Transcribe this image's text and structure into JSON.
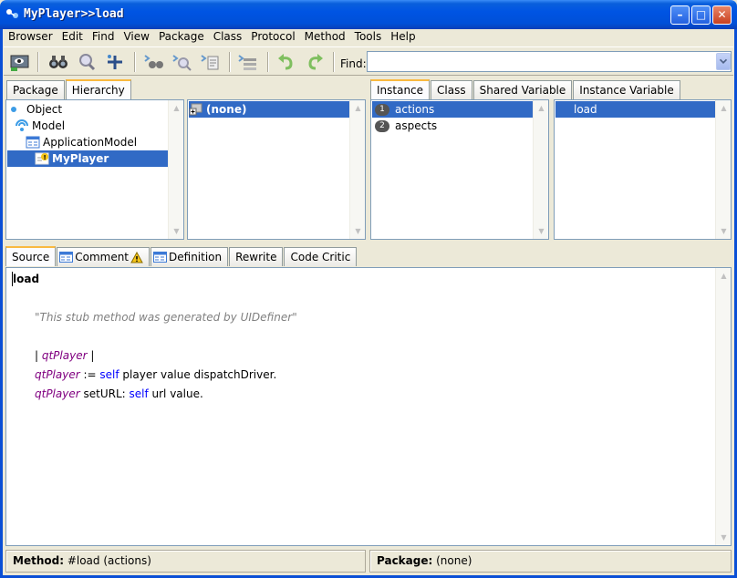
{
  "window": {
    "title": "MyPlayer>>load"
  },
  "menu": [
    "Browser",
    "Edit",
    "Find",
    "View",
    "Package",
    "Class",
    "Protocol",
    "Method",
    "Tools",
    "Help"
  ],
  "toolbar": {
    "find_label": "Find:",
    "find_value": ""
  },
  "left_tabs": [
    "Package",
    "Hierarchy"
  ],
  "hierarchy": [
    {
      "label": "Object",
      "icon": "dot-icon"
    },
    {
      "label": "Model",
      "icon": "model-icon"
    },
    {
      "label": "ApplicationModel",
      "icon": "appmodel-icon"
    },
    {
      "label": "MyPlayer",
      "icon": "myplayer-icon",
      "selected": true
    }
  ],
  "categories": [
    {
      "label": "(none)",
      "selected": true
    }
  ],
  "right_tabs": [
    "Instance",
    "Class",
    "Shared Variable",
    "Instance Variable"
  ],
  "protocols": [
    {
      "num": "1",
      "label": "actions",
      "selected": true
    },
    {
      "num": "2",
      "label": "aspects"
    }
  ],
  "methods": [
    {
      "label": "load",
      "selected": true
    }
  ],
  "code_tabs": [
    "Source",
    "Comment",
    "Definition",
    "Rewrite",
    "Code Critic"
  ],
  "source": {
    "selector": "load",
    "comment": "\"This stub method was generated by UIDefiner\"",
    "temps_open": "| ",
    "temps_var": "qtPlayer",
    "temps_close": " |",
    "line1_var": "qtPlayer",
    "line1_assign": " := ",
    "line1_self": "self",
    "line1_rest": " player value dispatchDriver.",
    "line2_var": "qtPlayer",
    "line2_mid": " setURL: ",
    "line2_self": "self",
    "line2_rest": " url value."
  },
  "status": {
    "method_label": "Method:",
    "method_value": " #load (actions)",
    "package_label": "Package:",
    "package_value": " (none)"
  }
}
